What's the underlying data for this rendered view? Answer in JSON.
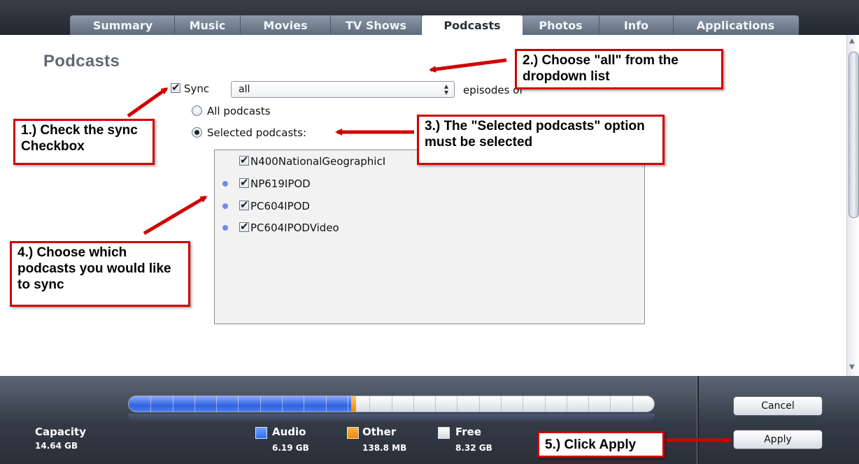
{
  "tabs": [
    {
      "label": "Summary",
      "active": false
    },
    {
      "label": "Music",
      "active": false
    },
    {
      "label": "Movies",
      "active": false
    },
    {
      "label": "TV Shows",
      "active": false
    },
    {
      "label": "Podcasts",
      "active": true
    },
    {
      "label": "Photos",
      "active": false
    },
    {
      "label": "Info",
      "active": false
    },
    {
      "label": "Applications",
      "active": false
    }
  ],
  "page": {
    "title": "Podcasts",
    "sync_label": "Sync",
    "sync_checked": true,
    "episodes_select": {
      "value": "all"
    },
    "episodes_suffix": "episodes of",
    "radio_all": {
      "label": "All podcasts",
      "selected": false
    },
    "radio_selected": {
      "label": "Selected podcasts:",
      "selected": true
    },
    "podcasts": [
      {
        "name": "N400NationalGeographicI",
        "checked": true,
        "unplayed_dot": false
      },
      {
        "name": "NP619IPOD",
        "checked": true,
        "unplayed_dot": true
      },
      {
        "name": "PC604IPOD",
        "checked": true,
        "unplayed_dot": true
      },
      {
        "name": "PC604IPODVideo",
        "checked": true,
        "unplayed_dot": true
      }
    ]
  },
  "annotations": {
    "step1": "1.) Check the sync Checkbox",
    "step2": "2.) Choose \"all\" from the dropdown list",
    "step3": "3.) The \"Selected podcasts\" option must be selected",
    "step4": "4.) Choose which podcasts you would like to sync",
    "step5": "5.) Click Apply",
    "color": "#d10000"
  },
  "capacity": {
    "label": "Capacity",
    "total": "14.64 GB",
    "audio_fraction": 0.423,
    "other_fraction": 0.009,
    "legend": [
      {
        "name": "Audio",
        "value": "6.19 GB",
        "color": "#2f6ee6"
      },
      {
        "name": "Other",
        "value": "138.8 MB",
        "color": "#f08a00"
      },
      {
        "name": "Free",
        "value": "8.32 GB",
        "color": "#e8eaee"
      }
    ]
  },
  "buttons": {
    "cancel": "Cancel",
    "apply": "Apply"
  }
}
